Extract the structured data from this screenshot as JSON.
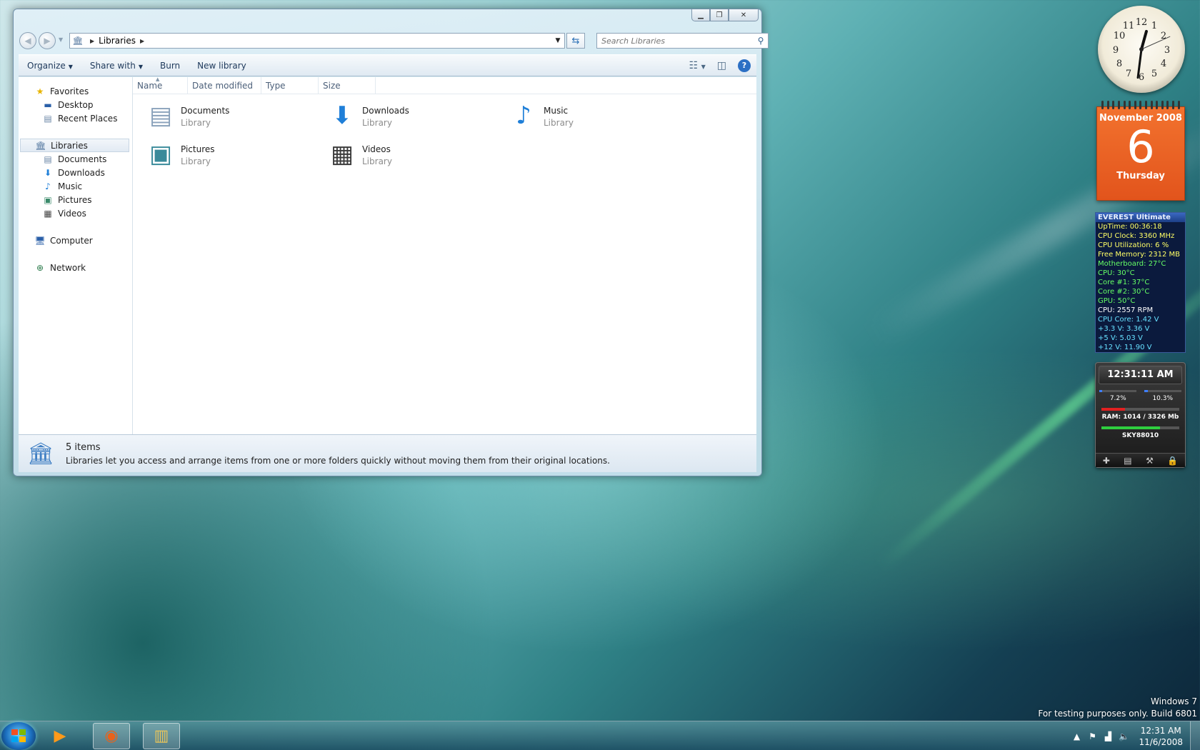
{
  "explorer": {
    "breadcrumb": "Libraries",
    "search_placeholder": "Search Libraries",
    "toolbar": {
      "organize": "Organize",
      "share_with": "Share with",
      "burn": "Burn",
      "new_library": "New library"
    },
    "nav": {
      "favorites": "Favorites",
      "desktop": "Desktop",
      "recent_places": "Recent Places",
      "libraries": "Libraries",
      "documents": "Documents",
      "downloads": "Downloads",
      "music": "Music",
      "pictures": "Pictures",
      "videos": "Videos",
      "computer": "Computer",
      "network": "Network"
    },
    "columns": {
      "name": "Name",
      "date_modified": "Date modified",
      "type": "Type",
      "size": "Size"
    },
    "items": [
      {
        "name": "Documents",
        "type": "Library",
        "icon": "documents-library-icon"
      },
      {
        "name": "Downloads",
        "type": "Library",
        "icon": "downloads-library-icon"
      },
      {
        "name": "Music",
        "type": "Library",
        "icon": "music-library-icon"
      },
      {
        "name": "Pictures",
        "type": "Library",
        "icon": "pictures-library-icon"
      },
      {
        "name": "Videos",
        "type": "Library",
        "icon": "videos-library-icon"
      }
    ],
    "details": {
      "count": "5 items",
      "description": "Libraries let you access and arrange items from one or more folders quickly without moving them from their original locations."
    }
  },
  "calendar": {
    "month": "November 2008",
    "day": "6",
    "weekday": "Thursday"
  },
  "clock_gadget": {
    "hour": 12,
    "minute": 31,
    "second": 11
  },
  "everest": {
    "title": "EVEREST Ultimate",
    "lines": [
      {
        "text": "UpTime: 00:36:18",
        "color": "#ffff66"
      },
      {
        "text": "CPU Clock: 3360 MHz",
        "color": "#ffff66"
      },
      {
        "text": "CPU Utilization: 6 %",
        "color": "#ffff66"
      },
      {
        "text": "Free Memory: 2312 MB",
        "color": "#ffff66"
      },
      {
        "text": "Motherboard: 27°C",
        "color": "#66ff66"
      },
      {
        "text": "CPU: 30°C",
        "color": "#66ff66"
      },
      {
        "text": "Core #1: 37°C",
        "color": "#66ff66"
      },
      {
        "text": "Core #2: 30°C",
        "color": "#66ff66"
      },
      {
        "text": "GPU: 50°C",
        "color": "#66ff66"
      },
      {
        "text": "CPU: 2557 RPM",
        "color": "#ffffff"
      },
      {
        "text": "CPU Core: 1.42 V",
        "color": "#66e0ff"
      },
      {
        "text": "+3.3 V: 3.36 V",
        "color": "#66e0ff"
      },
      {
        "text": "+5 V: 5.03 V",
        "color": "#66e0ff"
      },
      {
        "text": "+12 V: 11.90 V",
        "color": "#66e0ff"
      }
    ]
  },
  "meter": {
    "time": "12:31:11 AM",
    "cpu1_label": "7.2%",
    "cpu1_value": 0.072,
    "cpu2_label": "10.3%",
    "cpu2_value": 0.103,
    "ram_label": "RAM: 1014 / 3326 Mb",
    "ram_value": 0.305,
    "network_label": "SKY88010",
    "network_value": 0.75
  },
  "watermark": {
    "line1": "Windows 7",
    "line2": "For testing purposes only. Build 6801"
  },
  "taskbar": {
    "time": "12:31 AM",
    "date": "11/6/2008"
  },
  "colors": {
    "calendar_orange": "#e2541c",
    "everest_bg": "#0b1a3d",
    "accent_blue": "#2b6fc4"
  }
}
